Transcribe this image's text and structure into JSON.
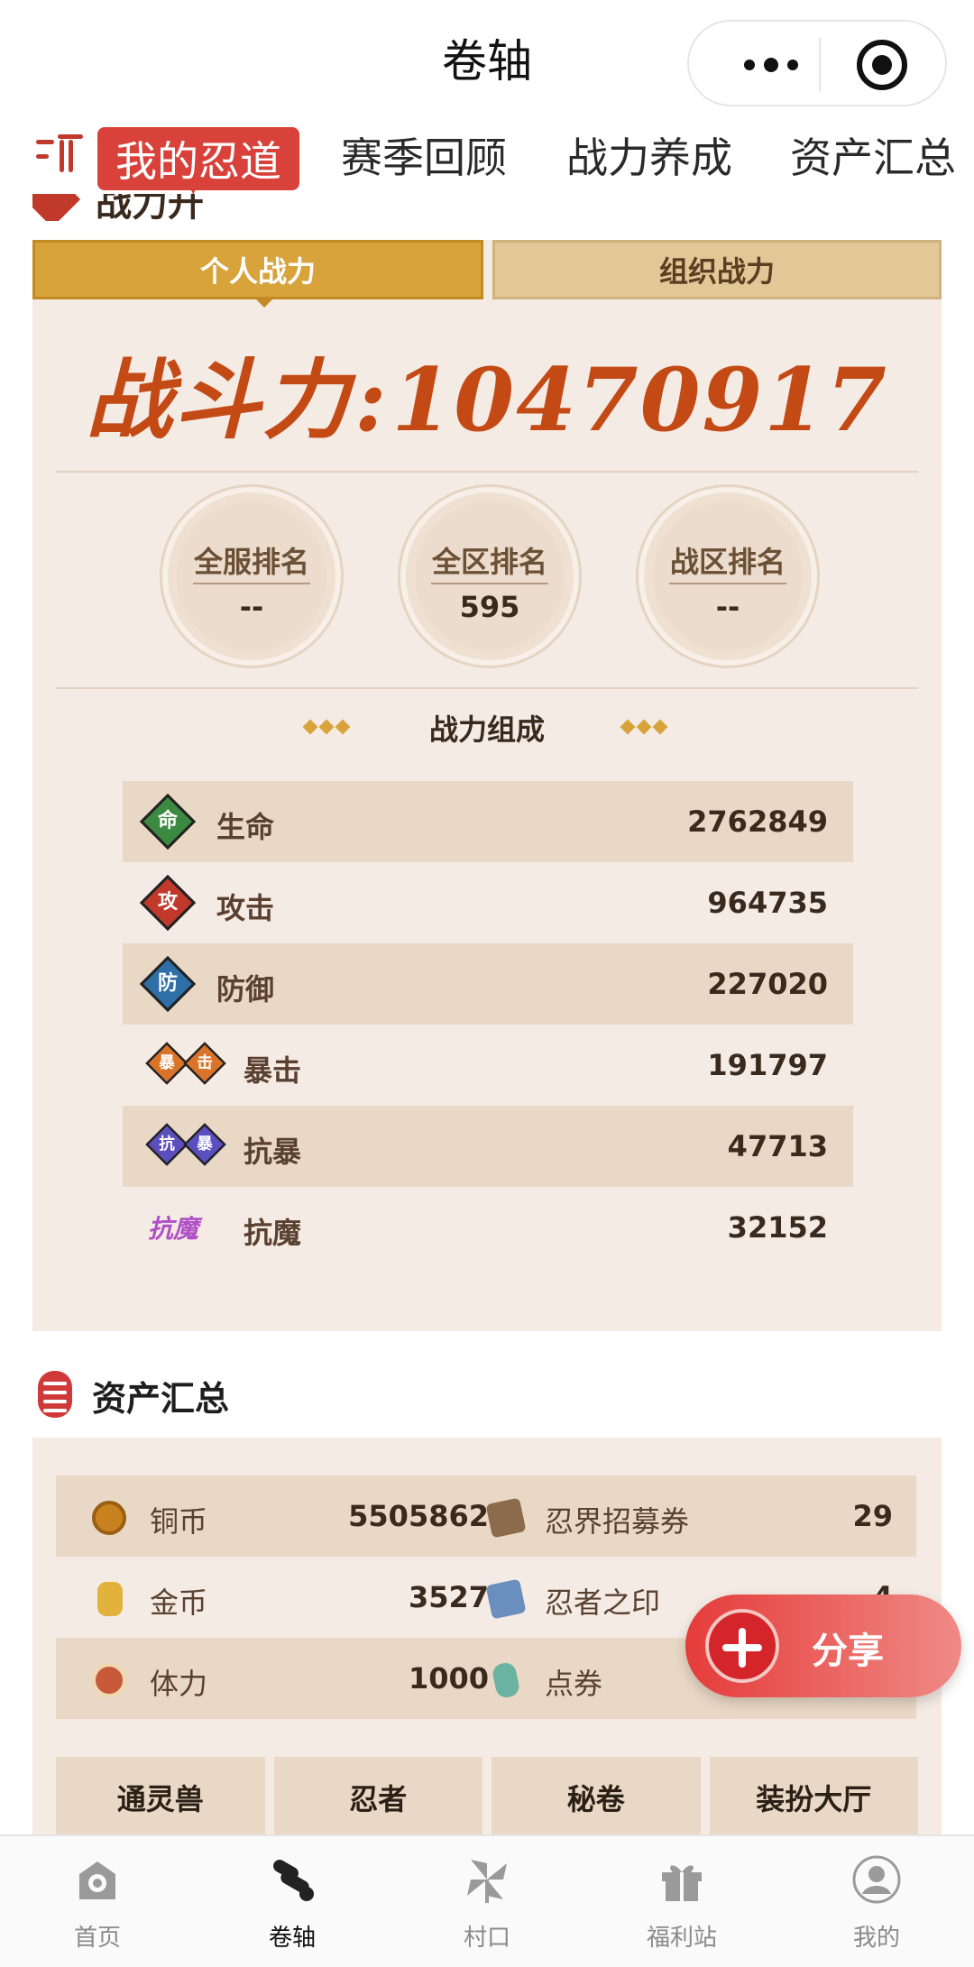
{
  "header": {
    "title": "卷轴"
  },
  "tabs": [
    "我的忍道",
    "赛季回顾",
    "战力养成",
    "资产汇总"
  ],
  "power": {
    "section_title": "战力升级",
    "seg_active": "个人战力",
    "seg_inactive": "组织战力",
    "label": "战斗力",
    "separator": ":",
    "value": "10470917",
    "ranks": [
      {
        "label": "全服排名",
        "value": "--"
      },
      {
        "label": "全区排名",
        "value": "595"
      },
      {
        "label": "战区排名",
        "value": "--"
      }
    ],
    "composition_title": "战力组成",
    "rows": [
      {
        "icon": "命",
        "name": "生命",
        "value": "2762849",
        "color": "#3c8a42"
      },
      {
        "icon": "攻",
        "name": "攻击",
        "value": "964735",
        "color": "#c0392b"
      },
      {
        "icon": "防",
        "name": "防御",
        "value": "227020",
        "color": "#2e6fa8"
      },
      {
        "icon": "暴击",
        "name": "暴击",
        "value": "191797",
        "color": "#d9742a"
      },
      {
        "icon": "抗暴",
        "name": "抗暴",
        "value": "47713",
        "color": "#5b4fc0"
      },
      {
        "icon": "抗魔",
        "name": "抗魔",
        "value": "32152",
        "color": "#b14fc6"
      }
    ]
  },
  "assets": {
    "title": "资产汇总",
    "rows": [
      {
        "left": {
          "name": "铜币",
          "value": "5505862",
          "color": "#c8821f"
        },
        "right": {
          "name": "忍界招募券",
          "value": "29",
          "color": "#8b6b4c"
        }
      },
      {
        "left": {
          "name": "金币",
          "value": "3527",
          "color": "#e2b33c"
        },
        "right": {
          "name": "忍者之印",
          "value": "4",
          "color": "#6a8ebd"
        }
      },
      {
        "left": {
          "name": "体力",
          "value": "1000",
          "color": "#c65a3a"
        },
        "right": {
          "name": "点券",
          "value": "",
          "color": "#6ab3a0"
        }
      }
    ],
    "buttons": [
      "通灵兽",
      "忍者",
      "秘卷",
      "装扮大厅"
    ]
  },
  "share": {
    "label": "分享"
  },
  "bottom_nav": [
    "首页",
    "卷轴",
    "村口",
    "福利站",
    "我的"
  ]
}
